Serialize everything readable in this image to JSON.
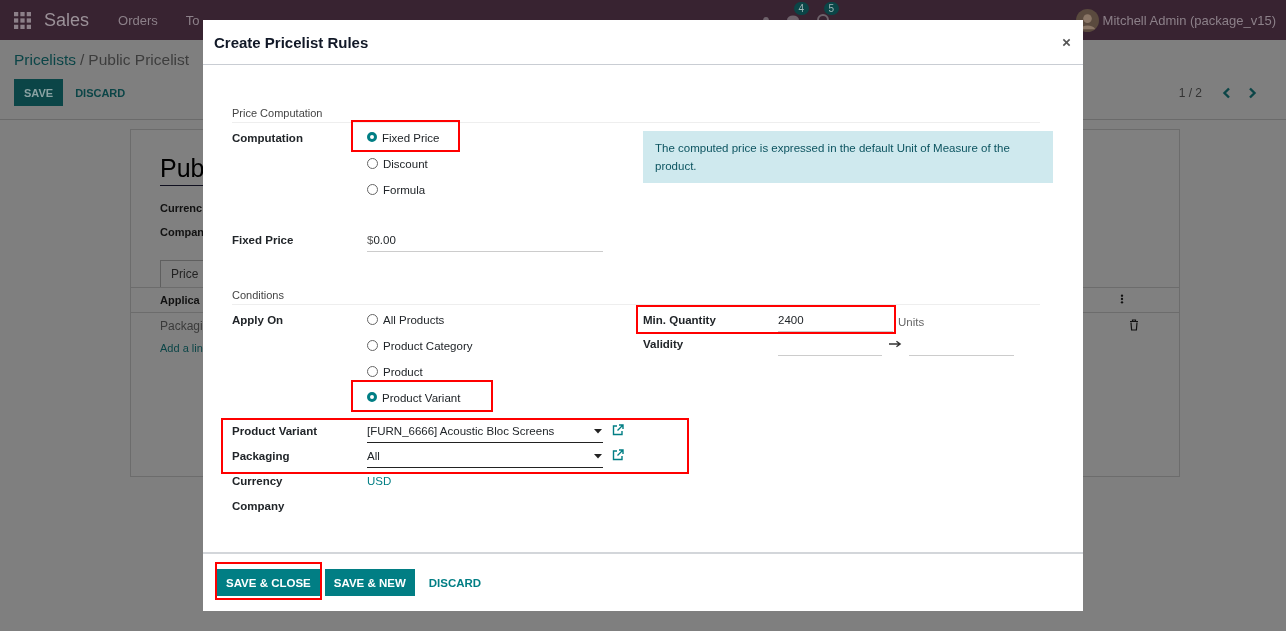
{
  "navbar": {
    "app_name": "Sales",
    "menu": [
      {
        "label": "Orders"
      },
      {
        "label": "To"
      }
    ],
    "messages_count": "4",
    "activities_count": "5",
    "user": "Mitchell Admin (package_v15)"
  },
  "breadcrumb": {
    "parent": "Pricelists",
    "separator": "/",
    "current": "Public Pricelist"
  },
  "control_panel": {
    "buttons": [
      {
        "label": "SAVE",
        "kind": "primary"
      },
      {
        "label": "DISCARD",
        "kind": "link"
      }
    ],
    "pager": "1 / 2"
  },
  "sheet": {
    "title": "Pub",
    "fields": [
      {
        "label": "Currenc"
      },
      {
        "label": "Compan"
      }
    ],
    "tabs": [
      {
        "label": "Price",
        "selected": true
      }
    ],
    "table": {
      "columns": [
        "Applica"
      ],
      "rows": [
        [
          "Packagi"
        ]
      ],
      "add_line": "Add a lin"
    }
  },
  "dialog": {
    "title": "Create Pricelist Rules",
    "price_computation": {
      "heading": "Price Computation",
      "computation": {
        "label": "Computation",
        "options": [
          {
            "label": "Fixed Price",
            "selected": true,
            "highlighted": true
          },
          {
            "label": "Discount",
            "selected": false,
            "highlighted": false
          },
          {
            "label": "Formula",
            "selected": false,
            "highlighted": false
          }
        ]
      },
      "note": "The computed price is expressed in the default Unit of Measure of the product.",
      "fixed_price": {
        "label": "Fixed Price",
        "currency_symbol": "$",
        "value": "0.00"
      }
    },
    "conditions": {
      "heading": "Conditions",
      "apply_on": {
        "label": "Apply On",
        "options": [
          {
            "label": "All Products",
            "selected": false,
            "highlighted": false
          },
          {
            "label": "Product Category",
            "selected": false,
            "highlighted": false
          },
          {
            "label": "Product",
            "selected": false,
            "highlighted": false
          },
          {
            "label": "Product Variant",
            "selected": true,
            "highlighted": true
          }
        ]
      },
      "min_quantity": {
        "label": "Min. Quantity",
        "value": "2400",
        "unit": "Units",
        "highlighted": true
      },
      "validity": {
        "label": "Validity"
      },
      "product_fields": {
        "highlighted": true,
        "fields": [
          {
            "label": "Product Variant",
            "value": "[FURN_6666] Acoustic Bloc Screens"
          },
          {
            "label": "Packaging",
            "value": "All"
          }
        ]
      },
      "currency": {
        "label": "Currency",
        "value": "USD"
      },
      "company": {
        "label": "Company"
      }
    },
    "buttons": [
      {
        "label": "SAVE & CLOSE",
        "kind": "primary",
        "highlighted": true
      },
      {
        "label": "SAVE & NEW",
        "kind": "primary",
        "highlighted": false
      },
      {
        "label": "DISCARD",
        "kind": "link",
        "highlighted": false
      }
    ]
  }
}
